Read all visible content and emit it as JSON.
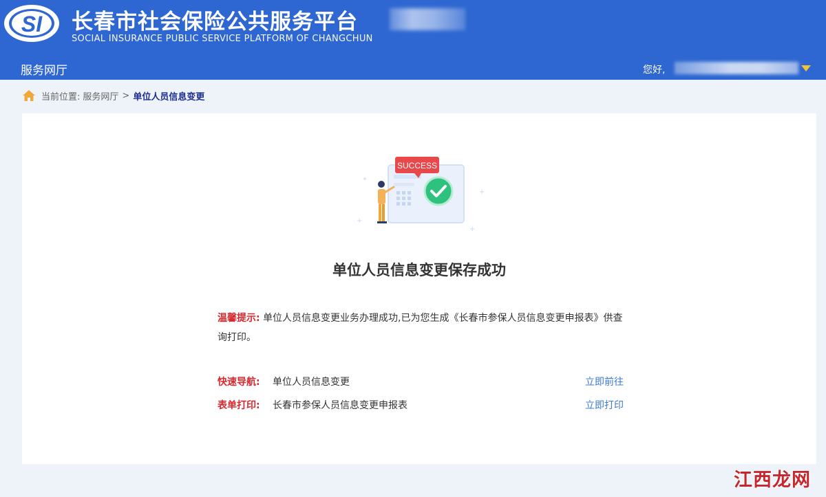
{
  "header": {
    "logo_text": "SI",
    "title": "长春市社会保险公共服务平台",
    "subtitle": "SOCIAL INSURANCE PUBLIC SERVICE PLATFORM OF CHANGCHUN",
    "nav_label": "服务网厅",
    "greeting": "您好,",
    "colors": {
      "background": "#2e67d1",
      "arrow": "#f2c230"
    }
  },
  "breadcrumb": {
    "prefix": "当前位置:",
    "items": [
      "服务网厅",
      "单位人员信息变更"
    ],
    "separator": ">"
  },
  "main": {
    "illustration_badge": "SUCCESS",
    "title": "单位人员信息变更保存成功",
    "tip": {
      "label": "温馨提示:",
      "text": "单位人员信息变更业务办理成功,已为您生成《长春市参保人员信息变更申报表》供查询打印。"
    },
    "quick_nav": {
      "label": "快速导航:",
      "value": "单位人员信息变更",
      "action": "立即前往"
    },
    "form_print": {
      "label": "表单打印:",
      "value": "长春市参保人员信息变更申报表",
      "action": "立即打印"
    },
    "colors": {
      "label_red": "#d9272e",
      "link_blue": "#3c78d8",
      "crumb_current": "#1c2f8f"
    }
  },
  "watermark": {
    "text": "江西龙网"
  }
}
